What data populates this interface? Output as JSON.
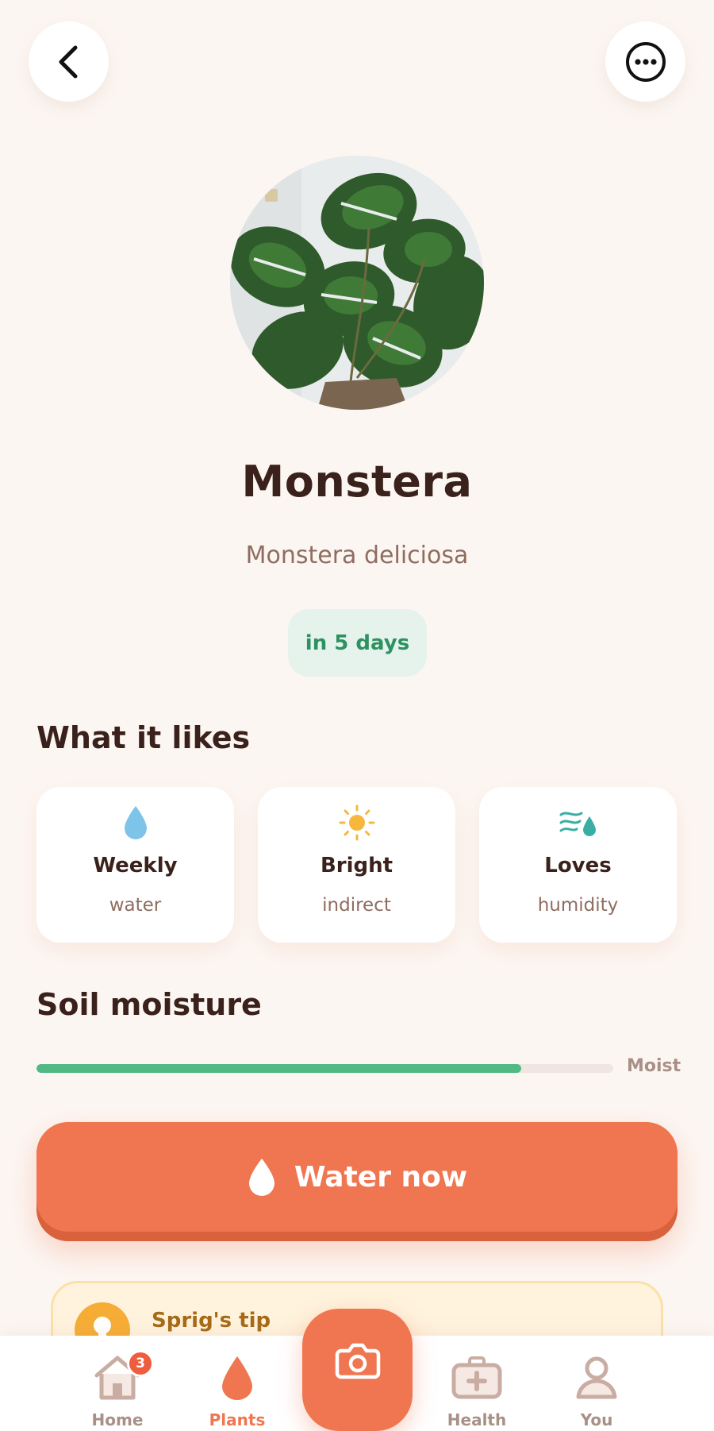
{
  "header": {
    "back_icon": "chevron-left-icon",
    "more_icon": "more-horizontal-icon"
  },
  "plant": {
    "name": "Monstera",
    "scientific_name": "Monstera deliciosa",
    "next_watering": "in 5 days"
  },
  "likes": {
    "heading": "What it likes",
    "items": [
      {
        "icon": "water-drop-icon",
        "title": "Weekly",
        "subtitle": "water",
        "color": "#7ec3e8"
      },
      {
        "icon": "sun-icon",
        "title": "Bright",
        "subtitle": "indirect",
        "color": "#f5b83d"
      },
      {
        "icon": "humidity-icon",
        "title": "Loves",
        "subtitle": "humidity",
        "color": "#3aaea4"
      }
    ]
  },
  "soil": {
    "heading": "Soil moisture",
    "level": 0.84,
    "label": "Moist"
  },
  "actions": {
    "water_now": "Water now"
  },
  "tip": {
    "title": "Sprig's tip"
  },
  "nav": {
    "items": [
      {
        "label": "Home",
        "icon": "home-icon",
        "badge": "3"
      },
      {
        "label": "Plants",
        "icon": "plant-drop-icon",
        "active": true
      },
      {
        "label": "Health",
        "icon": "first-aid-kit-icon"
      },
      {
        "label": "You",
        "icon": "user-icon"
      }
    ],
    "camera_icon": "camera-icon"
  },
  "colors": {
    "accent": "#ef7650",
    "background": "#fcf6f2",
    "moisture_fill": "#52b985",
    "pill_text": "#2e9162"
  }
}
